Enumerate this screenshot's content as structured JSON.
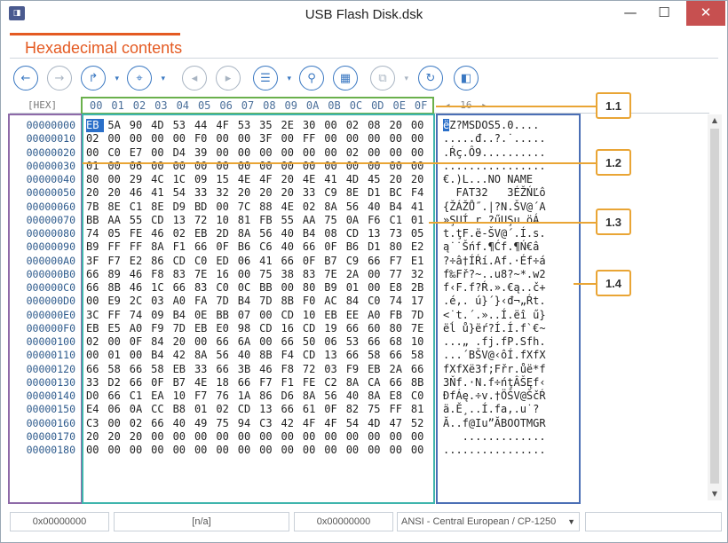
{
  "window": {
    "title": "USB Flash Disk.dsk",
    "app_icon_glyph": "◨",
    "controls": {
      "minimize": "—",
      "maximize": "☐",
      "close": "✕"
    }
  },
  "view": {
    "heading": "Hexadecimal contents"
  },
  "toolbar": {
    "buttons": [
      {
        "name": "back-button",
        "icon": "left-arrow-icon",
        "glyph": "←",
        "enabled": true
      },
      {
        "name": "forward-button",
        "icon": "right-arrow-icon",
        "glyph": "→",
        "enabled": false
      },
      {
        "name": "go-to-button",
        "icon": "redo-arrow-icon",
        "glyph": "↱",
        "enabled": true,
        "dropdown": "▾"
      },
      {
        "name": "bookmark-button",
        "icon": "bookmark-icon",
        "glyph": "⌖",
        "enabled": true,
        "dropdown": "▾"
      },
      {
        "name": "prev-bookmark-button",
        "icon": "prev-bookmark-icon",
        "glyph": "◂",
        "enabled": false
      },
      {
        "name": "next-bookmark-button",
        "icon": "next-bookmark-icon",
        "glyph": "▸",
        "enabled": false
      },
      {
        "name": "list-button",
        "icon": "list-icon",
        "glyph": "☰",
        "enabled": true,
        "dropdown": "▾"
      },
      {
        "name": "find-button",
        "icon": "search-icon",
        "glyph": "⚲",
        "enabled": true
      },
      {
        "name": "layout-button",
        "icon": "grid-icon",
        "glyph": "▦",
        "enabled": true
      },
      {
        "name": "copy-button",
        "icon": "copy-icon",
        "glyph": "⧉",
        "enabled": false,
        "dropdown": "▾"
      },
      {
        "name": "refresh-button",
        "icon": "refresh-icon",
        "glyph": "↻",
        "enabled": true
      },
      {
        "name": "panel-button",
        "icon": "panel-icon",
        "glyph": "◧",
        "enabled": true
      }
    ]
  },
  "hex_view": {
    "mode_label": "[HEX]",
    "column_headers": [
      "00",
      "01",
      "02",
      "03",
      "04",
      "05",
      "06",
      "07",
      "08",
      "09",
      "0A",
      "0B",
      "0C",
      "0D",
      "0E",
      "0F"
    ],
    "ascii_nav": {
      "left": "◂",
      "value": "16",
      "right": "▸"
    },
    "offsets": [
      "00000000",
      "00000010",
      "00000020",
      "00000030",
      "00000040",
      "00000050",
      "00000060",
      "00000070",
      "00000080",
      "00000090",
      "000000A0",
      "000000B0",
      "000000C0",
      "000000D0",
      "000000E0",
      "000000F0",
      "00000100",
      "00000110",
      "00000120",
      "00000130",
      "00000140",
      "00000150",
      "00000160",
      "00000170",
      "00000180"
    ],
    "rows": [
      [
        "EB",
        "5A",
        "90",
        "4D",
        "53",
        "44",
        "4F",
        "53",
        "35",
        "2E",
        "30",
        "00",
        "02",
        "08",
        "20",
        "00"
      ],
      [
        "02",
        "00",
        "00",
        "00",
        "00",
        "F0",
        "00",
        "00",
        "3F",
        "00",
        "FF",
        "00",
        "00",
        "00",
        "00",
        "00"
      ],
      [
        "00",
        "C0",
        "E7",
        "00",
        "D4",
        "39",
        "00",
        "00",
        "00",
        "00",
        "00",
        "00",
        "02",
        "00",
        "00",
        "00"
      ],
      [
        "01",
        "00",
        "06",
        "00",
        "00",
        "00",
        "00",
        "00",
        "00",
        "00",
        "00",
        "00",
        "00",
        "00",
        "00",
        "00"
      ],
      [
        "80",
        "00",
        "29",
        "4C",
        "1C",
        "09",
        "15",
        "4E",
        "4F",
        "20",
        "4E",
        "41",
        "4D",
        "45",
        "20",
        "20"
      ],
      [
        "20",
        "20",
        "46",
        "41",
        "54",
        "33",
        "32",
        "20",
        "20",
        "20",
        "33",
        "C9",
        "8E",
        "D1",
        "BC",
        "F4"
      ],
      [
        "7B",
        "8E",
        "C1",
        "8E",
        "D9",
        "BD",
        "00",
        "7C",
        "88",
        "4E",
        "02",
        "8A",
        "56",
        "40",
        "B4",
        "41"
      ],
      [
        "BB",
        "AA",
        "55",
        "CD",
        "13",
        "72",
        "10",
        "81",
        "FB",
        "55",
        "AA",
        "75",
        "0A",
        "F6",
        "C1",
        "01"
      ],
      [
        "74",
        "05",
        "FE",
        "46",
        "02",
        "EB",
        "2D",
        "8A",
        "56",
        "40",
        "B4",
        "08",
        "CD",
        "13",
        "73",
        "05"
      ],
      [
        "B9",
        "FF",
        "FF",
        "8A",
        "F1",
        "66",
        "0F",
        "B6",
        "C6",
        "40",
        "66",
        "0F",
        "B6",
        "D1",
        "80",
        "E2"
      ],
      [
        "3F",
        "F7",
        "E2",
        "86",
        "CD",
        "C0",
        "ED",
        "06",
        "41",
        "66",
        "0F",
        "B7",
        "C9",
        "66",
        "F7",
        "E1"
      ],
      [
        "66",
        "89",
        "46",
        "F8",
        "83",
        "7E",
        "16",
        "00",
        "75",
        "38",
        "83",
        "7E",
        "2A",
        "00",
        "77",
        "32"
      ],
      [
        "66",
        "8B",
        "46",
        "1C",
        "66",
        "83",
        "C0",
        "0C",
        "BB",
        "00",
        "80",
        "B9",
        "01",
        "00",
        "E8",
        "2B"
      ],
      [
        "00",
        "E9",
        "2C",
        "03",
        "A0",
        "FA",
        "7D",
        "B4",
        "7D",
        "8B",
        "F0",
        "AC",
        "84",
        "C0",
        "74",
        "17"
      ],
      [
        "3C",
        "FF",
        "74",
        "09",
        "B4",
        "0E",
        "BB",
        "07",
        "00",
        "CD",
        "10",
        "EB",
        "EE",
        "A0",
        "FB",
        "7D"
      ],
      [
        "EB",
        "E5",
        "A0",
        "F9",
        "7D",
        "EB",
        "E0",
        "98",
        "CD",
        "16",
        "CD",
        "19",
        "66",
        "60",
        "80",
        "7E"
      ],
      [
        "02",
        "00",
        "0F",
        "84",
        "20",
        "00",
        "66",
        "6A",
        "00",
        "66",
        "50",
        "06",
        "53",
        "66",
        "68",
        "10"
      ],
      [
        "00",
        "01",
        "00",
        "B4",
        "42",
        "8A",
        "56",
        "40",
        "8B",
        "F4",
        "CD",
        "13",
        "66",
        "58",
        "66",
        "58"
      ],
      [
        "66",
        "58",
        "66",
        "58",
        "EB",
        "33",
        "66",
        "3B",
        "46",
        "F8",
        "72",
        "03",
        "F9",
        "EB",
        "2A",
        "66"
      ],
      [
        "33",
        "D2",
        "66",
        "0F",
        "B7",
        "4E",
        "18",
        "66",
        "F7",
        "F1",
        "FE",
        "C2",
        "8A",
        "CA",
        "66",
        "8B"
      ],
      [
        "D0",
        "66",
        "C1",
        "EA",
        "10",
        "F7",
        "76",
        "1A",
        "86",
        "D6",
        "8A",
        "56",
        "40",
        "8A",
        "E8",
        "C0"
      ],
      [
        "E4",
        "06",
        "0A",
        "CC",
        "B8",
        "01",
        "02",
        "CD",
        "13",
        "66",
        "61",
        "0F",
        "82",
        "75",
        "FF",
        "81"
      ],
      [
        "C3",
        "00",
        "02",
        "66",
        "40",
        "49",
        "75",
        "94",
        "C3",
        "42",
        "4F",
        "4F",
        "54",
        "4D",
        "47",
        "52"
      ],
      [
        "20",
        "20",
        "20",
        "00",
        "00",
        "00",
        "00",
        "00",
        "00",
        "00",
        "00",
        "00",
        "00",
        "00",
        "00",
        "00"
      ],
      [
        "00",
        "00",
        "00",
        "00",
        "00",
        "00",
        "00",
        "00",
        "00",
        "00",
        "00",
        "00",
        "00",
        "00",
        "00",
        "00"
      ]
    ],
    "ascii": [
      "ëZ?MSDOS5.0....",
      ".....đ..?.˙.....",
      ".Ŕç.Ô9..........",
      "................",
      "€.)L...NO NAME  ",
      "  FAT32   3ÉŽŃĽô",
      "{ŽÁŽŮ˝.|?N.ŠV@´A",
      "»ŞUÍ.r.?űUŞu.öÁ.",
      "t.ţF.ë-ŠV@´.Í.s.",
      "ą˙˙Šńf.¶Ćf.¶Ń€â",
      "?÷â†ÍŔí.Af.·Éf÷á",
      "f‰Fř?~..u8?~*.w2",
      "f‹F.f?Ŕ.».€ą..č+",
      ".é,. ú}´}‹đ¬„Ŕt.",
      "<˙t.´.»..Í.ëî ű}",
      "ëĺ ů}ëŕ?Í.Í.f`€~",
      "...„ .fj.fP.Sfh.",
      "...´BŠV@‹ôÍ.fXfX",
      "fXfXë3f;Fřr.ůë*f",
      "3Ňf.·N.f÷ńţÂŠĘf‹",
      "ĐfÁę.÷v.†ÖŠV@ŠčŔ",
      "ä.Ě¸..Í.fa,.u˙?",
      "Ă..f@Iu”ĂBOOTMGR",
      "   .............",
      "................"
    ]
  },
  "callouts": [
    "1.1",
    "1.2",
    "1.3",
    "1.4"
  ],
  "statusbar": {
    "offset": "0x00000000",
    "selection": "[n/a]",
    "value": "0x00000000",
    "encoding": "ANSI - Central European / CP-1250",
    "encoding_dropdown": "▼",
    "extra": ""
  },
  "colors": {
    "accent": "#e45a22",
    "toolbar_blue": "#3a78c2",
    "header_box": "#6ab04c",
    "offset_box": "#8e6aa8",
    "hex_box": "#3fb5ad",
    "ascii_box": "#4b6fb5",
    "callout": "#e9a535",
    "selection": "#2a6fc9"
  }
}
